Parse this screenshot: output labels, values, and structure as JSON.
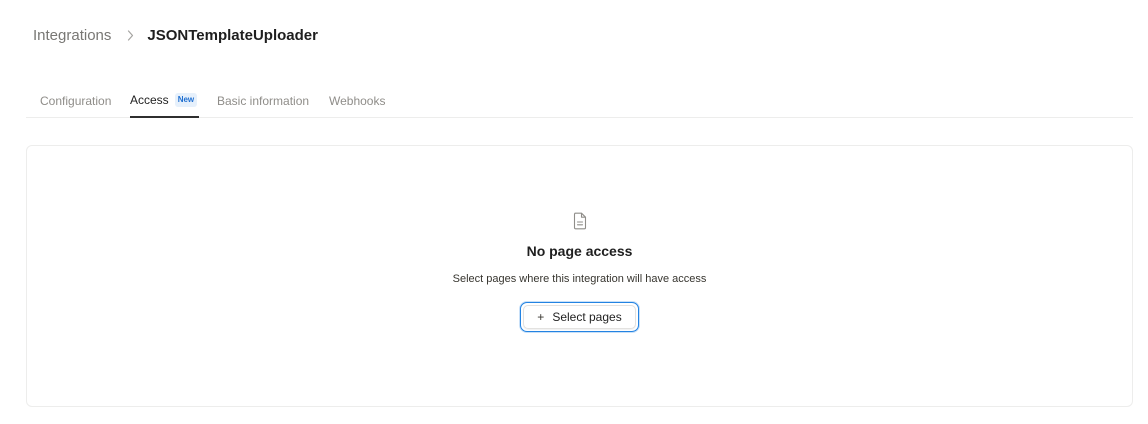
{
  "breadcrumb": {
    "parent": "Integrations",
    "separator_icon": "chevron-right-icon",
    "current": "JSONTemplateUploader"
  },
  "tabs": [
    {
      "label": "Configuration",
      "active": false
    },
    {
      "label": "Access",
      "active": true,
      "badge": "New"
    },
    {
      "label": "Basic information",
      "active": false
    },
    {
      "label": "Webhooks",
      "active": false
    }
  ],
  "empty_state": {
    "icon": "document-icon",
    "title": "No page access",
    "description": "Select pages where this integration will have access",
    "button": {
      "icon": "plus-icon",
      "plus": "+",
      "label": "Select pages"
    }
  },
  "colors": {
    "accent": "#2383e2",
    "badge_text": "#1f6fd1",
    "badge_bg": "#e6f0fb",
    "muted_text": "#8f8d89"
  }
}
